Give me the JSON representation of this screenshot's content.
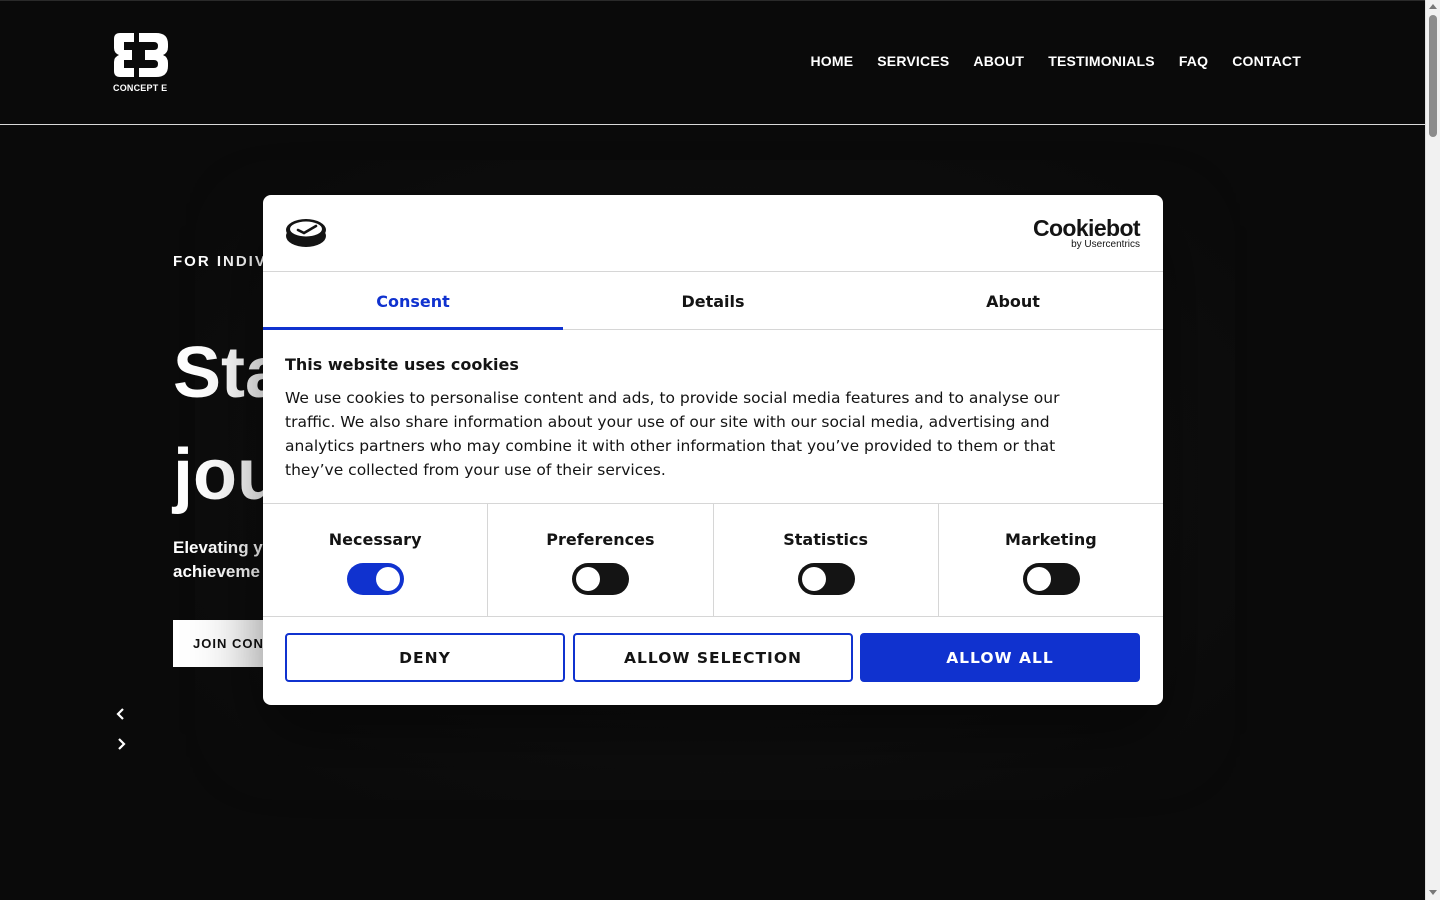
{
  "header": {
    "logo_text": "CONCEPT E",
    "nav": [
      "HOME",
      "SERVICES",
      "ABOUT",
      "TESTIMONIALS",
      "FAQ",
      "CONTACT"
    ]
  },
  "hero": {
    "eyebrow": "FOR INDIVI",
    "title_line1": "Sta",
    "title_line2": "jou",
    "subtitle_line1": "Elevating y",
    "subtitle_line2": "achieveme",
    "button": "JOIN CON"
  },
  "cookie_dialog": {
    "brand_name": "Cookiebot",
    "brand_by": "by Usercentrics",
    "tabs": [
      {
        "label": "Consent",
        "active": true
      },
      {
        "label": "Details",
        "active": false
      },
      {
        "label": "About",
        "active": false
      }
    ],
    "title": "This website uses cookies",
    "text": "We use cookies to personalise content and ads, to provide social media features and to analyse our traffic. We also share information about your use of our site with our social media, advertising and analytics partners who may combine it with other information that you’ve provided to them or that they’ve collected from your use of their services.",
    "toggles": [
      {
        "label": "Necessary",
        "on": true
      },
      {
        "label": "Preferences",
        "on": false
      },
      {
        "label": "Statistics",
        "on": false
      },
      {
        "label": "Marketing",
        "on": false
      }
    ],
    "buttons": {
      "deny": "DENY",
      "allow_selection": "ALLOW SELECTION",
      "allow_all": "ALLOW ALL"
    }
  },
  "colors": {
    "accent": "#1032cf",
    "page_bg": "#0a0a0a",
    "toggle_off": "#141414"
  }
}
